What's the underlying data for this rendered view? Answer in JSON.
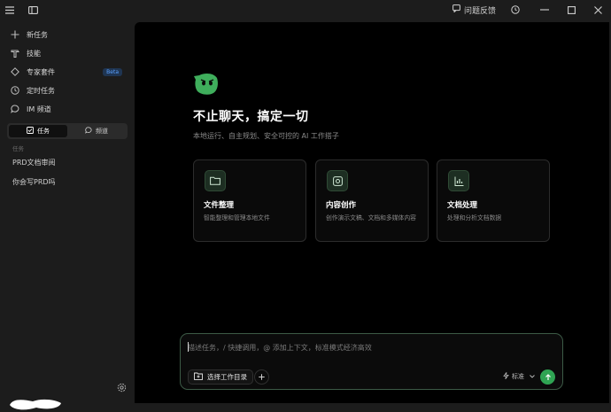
{
  "titlebar": {
    "feedback_label": "问题反馈"
  },
  "sidebar": {
    "nav": [
      {
        "label": "新任务",
        "icon": "plus-icon"
      },
      {
        "label": "技能",
        "icon": "hammer-icon"
      },
      {
        "label": "专家套件",
        "icon": "diamond-icon",
        "badge": "Beta"
      },
      {
        "label": "定时任务",
        "icon": "clock-icon"
      },
      {
        "label": "IM 频道",
        "icon": "chat-bubble-icon"
      }
    ],
    "tabs": [
      {
        "label": "任务",
        "active": true
      },
      {
        "label": "频道",
        "active": false
      }
    ],
    "section_label": "任务",
    "tasks": [
      "PRD文档审阅",
      "你会写PRD吗"
    ]
  },
  "hero": {
    "title": "不止聊天，搞定一切",
    "subtitle": "本地运行、自主规划、安全可控的 AI 工作搭子"
  },
  "cards": [
    {
      "title": "文件整理",
      "desc": "智能整理和管理本地文件",
      "icon": "folder-icon"
    },
    {
      "title": "内容创作",
      "desc": "创作演示文稿、文档和多媒体内容",
      "icon": "image-icon"
    },
    {
      "title": "文档处理",
      "desc": "处理和分析文档数据",
      "icon": "bar-chart-icon"
    }
  ],
  "composer": {
    "placeholder": "描述任务，/ 快捷调用，@ 添加上下文，标准模式经济高效",
    "dir_button": "选择工作目录",
    "mode_label": "标准"
  },
  "colors": {
    "accent": "#2fa453",
    "beta_badge": "#5aa0ff",
    "main_bg": "#000000",
    "sidebar_bg": "#1c1c1c"
  }
}
